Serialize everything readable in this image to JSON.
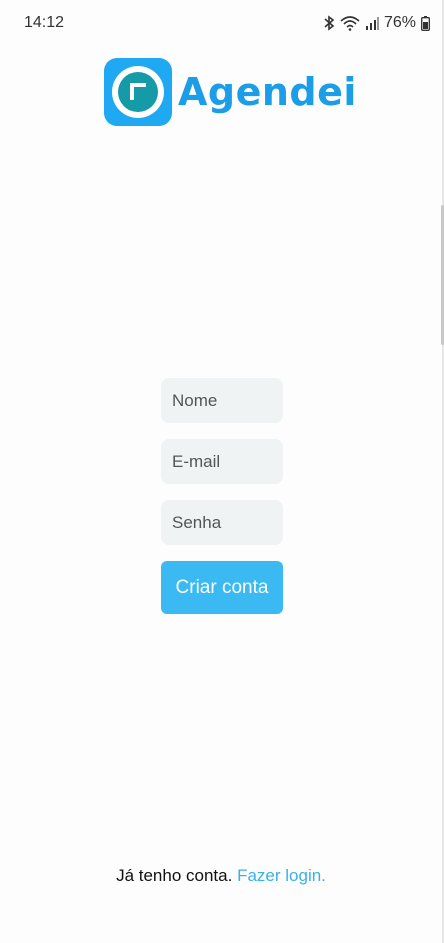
{
  "status_bar": {
    "time": "14:12",
    "battery": "76%",
    "icons": [
      "bluetooth-icon",
      "wifi-icon",
      "signal-icon",
      "battery-icon"
    ]
  },
  "logo": {
    "text": "Agendei",
    "color": "#1c9de8"
  },
  "form": {
    "name_placeholder": "Nome",
    "email_placeholder": "E-mail",
    "password_placeholder": "Senha",
    "submit_label": "Criar conta"
  },
  "footer": {
    "text": "Já tenho conta.",
    "link_label": "Fazer login."
  },
  "colors": {
    "accent": "#3bb9f3",
    "input_bg": "#f0f3f3"
  }
}
